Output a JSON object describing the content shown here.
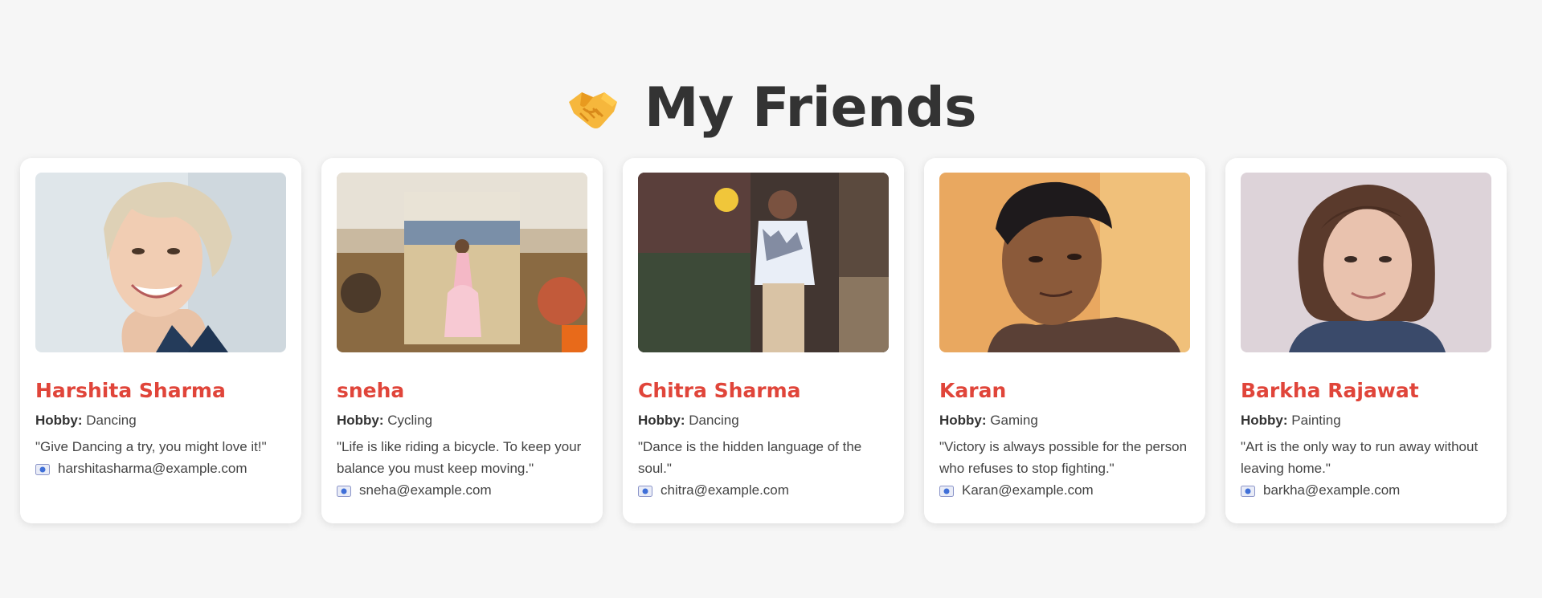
{
  "header": {
    "title": "My Friends",
    "icon": "handshake-icon"
  },
  "friends": [
    {
      "name": "Harshita Sharma",
      "hobby_label": "Hobby:",
      "hobby": "Dancing",
      "quote": "\"Give Dancing a try, you might love it!\"",
      "email": "harshitasharma@example.com",
      "photo": "portrait-photo"
    },
    {
      "name": "sneha",
      "hobby_label": "Hobby:",
      "hobby": "Cycling",
      "quote": "\"Life is like riding a bicycle. To keep your balance you must keep moving.\"",
      "email": "sneha@example.com",
      "photo": "portrait-photo"
    },
    {
      "name": "Chitra Sharma",
      "hobby_label": "Hobby:",
      "hobby": "Dancing",
      "quote": "\"Dance is the hidden language of the soul.\"",
      "email": "chitra@example.com",
      "photo": "portrait-photo"
    },
    {
      "name": "Karan",
      "hobby_label": "Hobby:",
      "hobby": "Gaming",
      "quote": "\"Victory is always possible for the person who refuses to stop fighting.\"",
      "email": "Karan@example.com",
      "photo": "portrait-photo"
    },
    {
      "name": "Barkha Rajawat",
      "hobby_label": "Hobby:",
      "hobby": "Painting",
      "quote": "\"Art is the only way to run away without leaving home.\"",
      "email": "barkha@example.com",
      "photo": "portrait-photo"
    }
  ],
  "colors": {
    "accent": "#e0453a",
    "background": "#f6f6f6",
    "card": "#ffffff",
    "title": "#333333"
  }
}
